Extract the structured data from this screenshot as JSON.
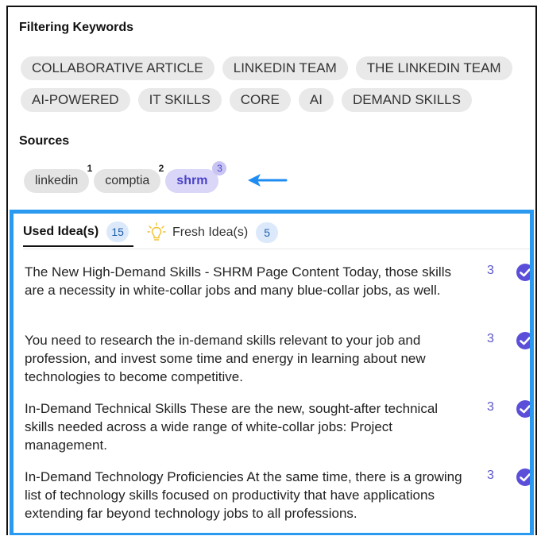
{
  "keywords": {
    "title": "Filtering Keywords",
    "items": [
      "COLLABORATIVE ARTICLE",
      "LINKEDIN TEAM",
      "THE LINKEDIN TEAM",
      "AI-POWERED",
      "IT SKILLS",
      "CORE",
      "AI",
      "DEMAND SKILLS"
    ]
  },
  "sources": {
    "title": "Sources",
    "items": [
      {
        "label": "linkedin",
        "count": "1",
        "active": false
      },
      {
        "label": "comptia",
        "count": "2",
        "active": false
      },
      {
        "label": "shrm",
        "count": "3",
        "active": true
      }
    ]
  },
  "colors": {
    "accent_border": "#2a9af0",
    "active_chip": "#d9d6f7",
    "check": "#5b4fd9",
    "arrow": "#1e8cf0"
  },
  "tabs": {
    "used": {
      "label": "Used Idea(s)",
      "count": "15"
    },
    "fresh": {
      "label": "Fresh Idea(s)",
      "count": "5",
      "icon": "lightbulb-icon"
    }
  },
  "ideas": [
    {
      "text": "The New High-Demand Skills - SHRM Page Content Today, those skills are a necessity in white-collar jobs and many blue-collar jobs, as well.",
      "count": "3",
      "checked": true
    },
    {
      "text": "You need to research the in-demand skills relevant to your job and profession, and invest some time and energy in learning about new technologies to become competitive.",
      "count": "3",
      "checked": true
    },
    {
      "text": "In-Demand Technical Skills These are the new, sought-after technical skills needed across a wide range of white-collar jobs: Project management.",
      "count": "3",
      "checked": true
    },
    {
      "text": "In-Demand Technology Proficiencies At the same time, there is a growing list of technology skills focused on productivity that have applications extending far beyond technology jobs to all professions.",
      "count": "3",
      "checked": true
    }
  ]
}
